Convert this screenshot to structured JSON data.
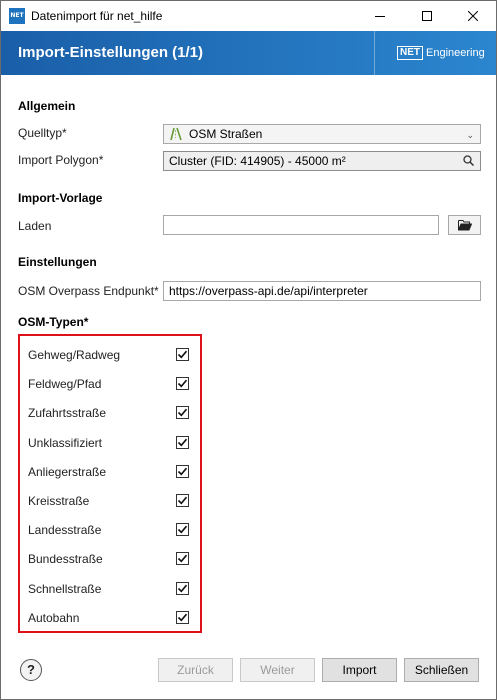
{
  "window": {
    "title": "Datenimport für net_hilfe",
    "app_icon_text": "NET"
  },
  "banner": {
    "title": "Import-Einstellungen (1/1)",
    "logo_box": "NET",
    "logo_text": "Engineering"
  },
  "allgemein": {
    "heading": "Allgemein",
    "quelltyp_label": "Quelltyp*",
    "quelltyp_value": "OSM Straßen",
    "polygon_label": "Import Polygon*",
    "polygon_value": "Cluster (FID: 414905) - 45000 m²"
  },
  "vorlage": {
    "heading": "Import-Vorlage",
    "laden_label": "Laden",
    "laden_value": ""
  },
  "einstellungen": {
    "heading": "Einstellungen",
    "endpoint_label": "OSM Overpass Endpunkt*",
    "endpoint_value": "https://overpass-api.de/api/interpreter"
  },
  "osm_types": {
    "heading": "OSM-Typen*",
    "items": [
      {
        "label": "Gehweg/Radweg",
        "checked": true
      },
      {
        "label": "Feldweg/Pfad",
        "checked": true
      },
      {
        "label": "Zufahrtsstraße",
        "checked": true
      },
      {
        "label": "Unklassifiziert",
        "checked": true
      },
      {
        "label": "Anliegerstraße",
        "checked": true
      },
      {
        "label": "Kreisstraße",
        "checked": true
      },
      {
        "label": "Landesstraße",
        "checked": true
      },
      {
        "label": "Bundesstraße",
        "checked": true
      },
      {
        "label": "Schnellstraße",
        "checked": true
      },
      {
        "label": "Autobahn",
        "checked": true
      }
    ],
    "highlight_color": "#e0101a"
  },
  "footer": {
    "help_label": "?",
    "back_label": "Zurück",
    "next_label": "Weiter",
    "import_label": "Import",
    "close_label": "Schließen"
  },
  "colors": {
    "banner_start": "#1a5ea8",
    "banner_end": "#2b86cf"
  }
}
